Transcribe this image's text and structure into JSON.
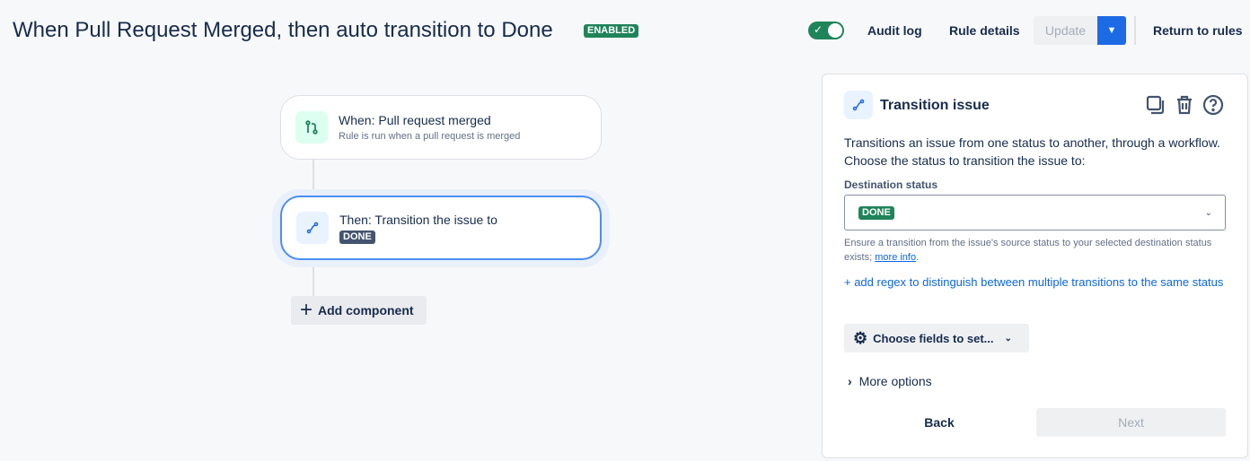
{
  "header": {
    "title": "When Pull Request Merged, then auto transition to Done",
    "status_badge": "ENABLED",
    "toggle_on": true,
    "audit_log": "Audit log",
    "rule_details": "Rule details",
    "update": "Update",
    "return": "Return to rules"
  },
  "flow": {
    "trigger_title": "When: Pull request merged",
    "trigger_sub": "Rule is run when a pull request is merged",
    "action_title": "Then: Transition the issue to",
    "action_status": "DONE",
    "add_component": "Add component"
  },
  "panel": {
    "title": "Transition issue",
    "description": "Transitions an issue from one status to another, through a workflow. Choose the status to transition the issue to:",
    "field_label": "Destination status",
    "selected": "DONE",
    "help_text": "Ensure a transition from the issue's source status to your selected destination status exists;",
    "help_link": "more info",
    "help_end": ".",
    "regex_link": "+ add regex to distinguish between multiple transitions to the same status",
    "choose_fields": "Choose fields to set...",
    "more_options": "More options",
    "back": "Back",
    "next": "Next"
  },
  "colors": {
    "accent": "#1d6ae5",
    "success": "#1f845a",
    "dark_badge": "#44546f"
  }
}
